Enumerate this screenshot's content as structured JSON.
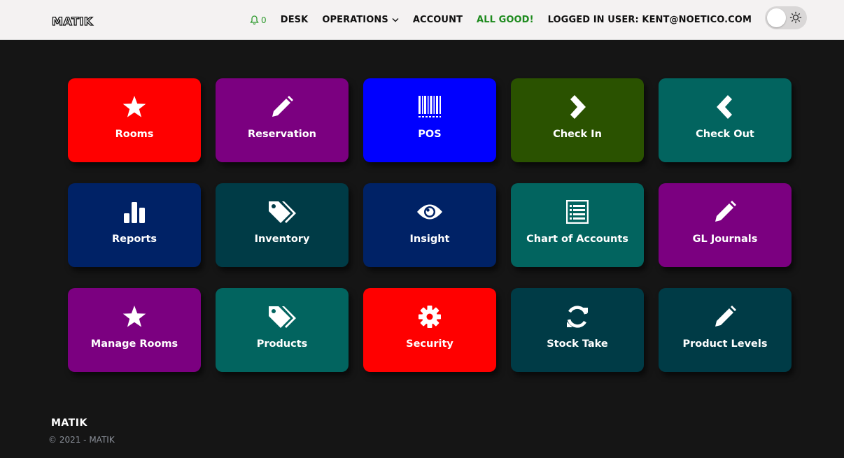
{
  "header": {
    "logo_text": "MATIK",
    "notifications_count": "0",
    "nav": {
      "desk": "DESK",
      "operations": "OPERATIONS",
      "account": "ACCOUNT",
      "status": "ALL GOOD!",
      "user": "LOGGED IN USER: KENT@NOETICO.COM"
    },
    "theme_toggle": {
      "state": "light",
      "icon": "sun-icon"
    }
  },
  "tiles": [
    {
      "label": "Rooms",
      "icon": "star-icon",
      "color": "#ff0000"
    },
    {
      "label": "Reservation",
      "icon": "pencil-icon",
      "color": "#7b0080"
    },
    {
      "label": "POS",
      "icon": "barcode-icon",
      "color": "#0000ff"
    },
    {
      "label": "Check In",
      "icon": "chevron-right-icon",
      "color": "#2a5200"
    },
    {
      "label": "Check Out",
      "icon": "chevron-left-icon",
      "color": "#02645f"
    },
    {
      "label": "Reports",
      "icon": "bar-chart-icon",
      "color": "#002266"
    },
    {
      "label": "Inventory",
      "icon": "tags-icon",
      "color": "#003b46"
    },
    {
      "label": "Insight",
      "icon": "eye-icon",
      "color": "#002266"
    },
    {
      "label": "Chart of Accounts",
      "icon": "list-icon",
      "color": "#02645f"
    },
    {
      "label": "GL Journals",
      "icon": "pencil-icon",
      "color": "#7b0080"
    },
    {
      "label": "Manage Rooms",
      "icon": "star-icon",
      "color": "#7b0080"
    },
    {
      "label": "Products",
      "icon": "tags-icon",
      "color": "#02645f"
    },
    {
      "label": "Security",
      "icon": "gear-icon",
      "color": "#ff0000"
    },
    {
      "label": "Stock Take",
      "icon": "refresh-icon",
      "color": "#003b46"
    },
    {
      "label": "Product Levels",
      "icon": "pencil-icon",
      "color": "#003b46"
    }
  ],
  "footer": {
    "logo_text": "MATIK",
    "copyright": "© 2021 - MATIK"
  }
}
